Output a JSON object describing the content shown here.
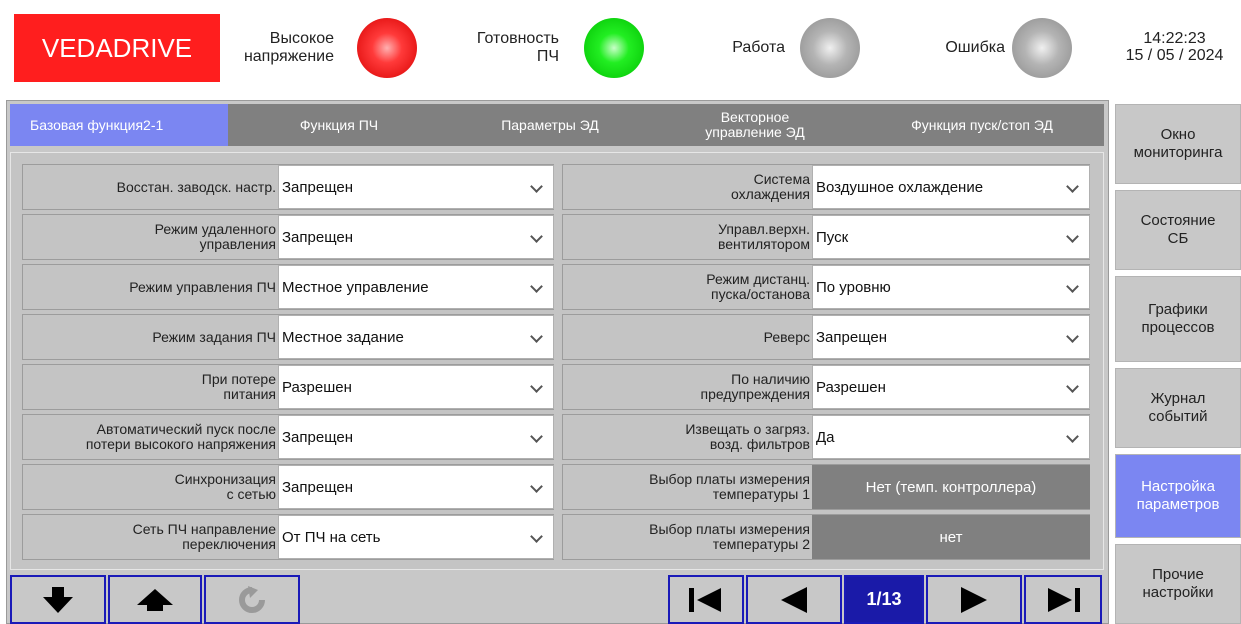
{
  "header": {
    "logo": "VEDADRIVE",
    "indicators": [
      {
        "label": "Высокое\nнапряжение",
        "state": "red",
        "color": "#ff2a2a"
      },
      {
        "label": "Готовность\nПЧ",
        "state": "green",
        "color": "#22ee22"
      },
      {
        "label": "Работа",
        "state": "off",
        "color": "#a0a0a0"
      },
      {
        "label": "Ошибка",
        "state": "off",
        "color": "#a0a0a0"
      }
    ],
    "time": "14:22:23",
    "date": "15 / 05 / 2024"
  },
  "tabs": [
    {
      "label": "Базовая функция2-1",
      "active": true
    },
    {
      "label": "Функция ПЧ",
      "active": false
    },
    {
      "label": "Параметры ЭД",
      "active": false
    },
    {
      "label": "Векторное\nуправление ЭД",
      "active": false
    },
    {
      "label": "Функция пуск/стоп ЭД",
      "active": false
    }
  ],
  "left_params": [
    {
      "label": "Восстан. заводск. настр.",
      "value": "Запрещен"
    },
    {
      "label": "Режим удаленного\nуправления",
      "value": "Запрещен"
    },
    {
      "label": "Режим управления ПЧ",
      "value": "Местное управление"
    },
    {
      "label": "Режим задания ПЧ",
      "value": "Местное задание"
    },
    {
      "label": "При потере\nпитания",
      "value": "Разрешен"
    },
    {
      "label": "Автоматический пуск после\nпотери высокого напряжения",
      "value": "Запрещен"
    },
    {
      "label": "Синхронизация\nс сетью",
      "value": "Запрещен"
    },
    {
      "label": "Сеть ПЧ направление\nпереключения",
      "value": "От ПЧ на сеть"
    }
  ],
  "right_params": [
    {
      "label": "Система\nохлаждения",
      "value": "Воздушное охлаждение"
    },
    {
      "label": "Управл.верхн.\nвентилятором",
      "value": "Пуск"
    },
    {
      "label": "Режим дистанц.\nпуска/останова",
      "value": "По уровню"
    },
    {
      "label": "Реверс",
      "value": "Запрещен"
    },
    {
      "label": "По наличию\nпредупреждения",
      "value": "Разрешен"
    },
    {
      "label": "Извещать о загряз.\nвозд. фильтров",
      "value": "Да"
    },
    {
      "label": "Выбор платы измерения\nтемпературы 1",
      "value": "Нет (темп. контроллера)",
      "readonly": true
    },
    {
      "label": "Выбор платы измерения\nтемпературы 2",
      "value": "нет",
      "readonly": true
    }
  ],
  "toolbar": {
    "icons": [
      "arrow-down-icon",
      "arrow-up-icon",
      "refresh-icon",
      "first-page-icon",
      "prev-page-icon",
      "next-page-icon",
      "last-page-icon"
    ],
    "page": "1/13"
  },
  "side_nav": [
    {
      "label": "Окно\nмониторинга",
      "active": false
    },
    {
      "label": "Состояние\nСБ",
      "active": false
    },
    {
      "label": "Графики\nпроцессов",
      "active": false
    },
    {
      "label": "Журнал\nсобытий",
      "active": false
    },
    {
      "label": "Настройка\nпараметров",
      "active": true
    },
    {
      "label": "Прочие\nнастройки",
      "active": false
    }
  ],
  "colors": {
    "accent": "#7b86f2",
    "logo_bg": "#ff1e1e",
    "toolbar_border": "#1a1ab8",
    "page_indicator": "#1a1aa8"
  }
}
